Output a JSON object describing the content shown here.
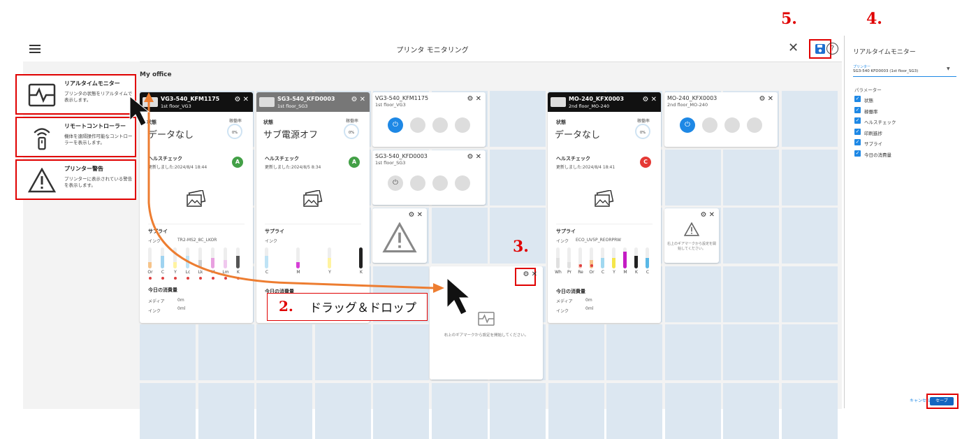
{
  "app": {
    "title": "プリンタ モニタリング",
    "office": "My office"
  },
  "side_menu": [
    {
      "title": "リアルタイムモニター",
      "desc": "プリンタの状態をリアルタイムで表示します。"
    },
    {
      "title": "リモートコントローラー",
      "desc": "機体を遠隔操作可能なコントローラーを表示します。"
    },
    {
      "title": "プリンター警告",
      "desc": "プリンターに表示されている警告を表示します。"
    }
  ],
  "cards": {
    "vg3_big": {
      "name": "VG3-540_KFM1175",
      "location": "1st floor_VG3",
      "status_label": "状態",
      "status_value": "データなし",
      "uptime_label": "稼働率",
      "uptime_value": "0%",
      "health_label": "ヘルスチェック",
      "health_updated": "更新しました:2024/8/4 18:44",
      "health_grade": "A",
      "supply_label": "サプライ",
      "ink_label": "インク",
      "ink_model": "TR2-MS2_8C_LKOR",
      "inks": [
        "Or",
        "C",
        "Y",
        "Lc",
        "Lk",
        "M",
        "Lm",
        "K"
      ],
      "consumption_label": "今日の消費量",
      "media_label": "メディア",
      "media_value": "0m",
      "ink_used_label": "インク",
      "ink_used_value": "0ml"
    },
    "sg3_big": {
      "name": "SG3-540_KFD0003",
      "location": "1st floor_SG3",
      "status_label": "状態",
      "status_value": "サブ電源オフ",
      "uptime_label": "稼働率",
      "uptime_value": "0%",
      "health_label": "ヘルスチェック",
      "health_updated": "更新しました:2024/8/5 8:34",
      "health_grade": "A",
      "supply_label": "サプライ",
      "ink_label": "インク",
      "inks": [
        "C",
        "M",
        "Y",
        "K"
      ],
      "consumption_label": "今日の消費量"
    },
    "vg3_small": {
      "name": "VG3-540_KFM1175",
      "location": "1st floor_VG3"
    },
    "sg3_small": {
      "name": "SG3-540_KFD0003",
      "location": "1st floor_SG3"
    },
    "mo240_big": {
      "name": "MO-240_KFX0003",
      "location": "2nd floor_MO-240",
      "status_label": "状態",
      "status_value": "データなし",
      "uptime_label": "稼働率",
      "uptime_value": "0%",
      "health_label": "ヘルスチェック",
      "health_updated": "更新しました:2024/8/4 18:41",
      "health_grade": "C",
      "supply_label": "サプライ",
      "ink_label": "インク",
      "ink_model": "ECO_UV5P_REORPRW",
      "inks": [
        "Wh",
        "Pr",
        "Re",
        "Or",
        "C",
        "Y",
        "M",
        "K",
        "C"
      ],
      "consumption_label": "今日の消費量",
      "media_label": "メディア",
      "media_value": "0m",
      "ink_used_label": "インク",
      "ink_used_value": "0ml"
    },
    "mo240_small": {
      "name": "MO-240_KFX0003",
      "location": "2nd floor_MO-240"
    },
    "warn_small_text": "右上のギアマークから設定を開始してください。",
    "new_widget_text": "右上のギアマークから設定を開始してください。"
  },
  "panel": {
    "title": "リアルタイムモニター",
    "printer_label": "プリンター",
    "printer_value": "SG3-540 KFD0003 (1st floor_SG3)",
    "params_label": "パラメーター",
    "params": [
      "状態",
      "稼働率",
      "ヘルスチェック",
      "印刷進捗",
      "サプライ",
      "今日の消費量"
    ],
    "cancel": "キャンセル",
    "save": "セーブ"
  },
  "annotations": {
    "step2": "2.",
    "step2_text": "ドラッグ＆ドロップ",
    "step3": "3.",
    "step4": "4.",
    "step5": "5."
  },
  "colors": {
    "accent": "#1e88e5",
    "annotation_red": "#e00000",
    "arrow_orange": "#ed7d31",
    "grid_cell": "#dce7f1"
  }
}
